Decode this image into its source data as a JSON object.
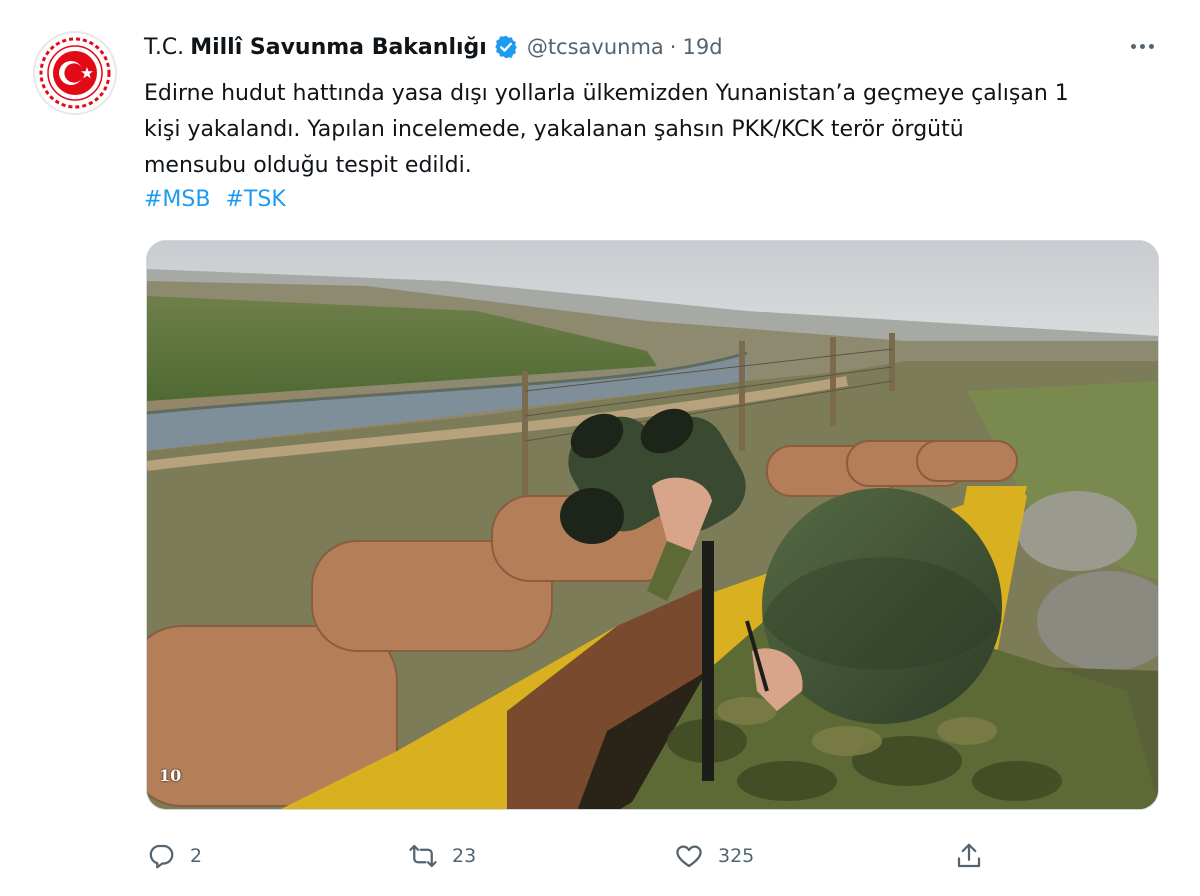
{
  "account": {
    "name_prefix": "T.C.",
    "name_main": "Millî Savunma Bakanlığı",
    "verified": true,
    "handle": "@tcsavunma",
    "separator": "·",
    "time": "19d",
    "avatar_icon": "turkish-crescent-star-emblem"
  },
  "tweet": {
    "lines": [
      "Edirne hudut hattında yasa dışı yollarla ülkemizden Yunanistan’a geçmeye çalışan 1",
      "kişi yakalandı. Yapılan incelemede, yakalanan şahsın PKK/KCK terör örgütü",
      "mensubu olduğu tespit edildi."
    ],
    "hashtags": [
      "#MSB",
      "#TSK"
    ]
  },
  "media": {
    "badge": "10",
    "description_icon": "soldier-with-binoculars-photo"
  },
  "actions": {
    "reply": {
      "icon": "reply-icon",
      "count": "2"
    },
    "retweet": {
      "icon": "retweet-icon",
      "count": "23"
    },
    "like": {
      "icon": "heart-icon",
      "count": "325"
    },
    "share": {
      "icon": "share-icon"
    }
  },
  "colors": {
    "link": "#1d9bf0",
    "muted": "#536471",
    "text": "#0f1419",
    "emblem_red": "#e30a17"
  }
}
